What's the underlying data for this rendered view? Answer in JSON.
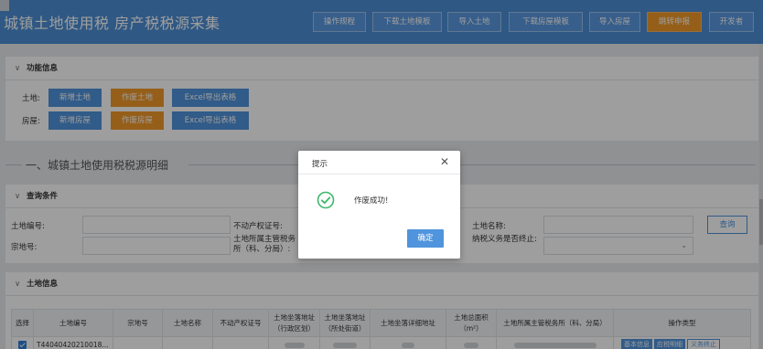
{
  "header": {
    "title": "城镇土地使用税 房产税税源采集",
    "buttons": [
      "操作规程",
      "下载土地模板",
      "导入土地",
      "下载房屋模板",
      "导入房屋",
      "跳转申报",
      "开发者"
    ]
  },
  "function_panel": {
    "title": "功能信息",
    "land_label": "土地:",
    "house_label": "房屋:",
    "land_buttons": [
      "新增土地",
      "作废土地",
      "Excel导出表格"
    ],
    "house_buttons": [
      "新增房屋",
      "作废房屋",
      "Excel导出表格"
    ]
  },
  "section_title": "一、城镇土地使用税税源明细",
  "query_panel": {
    "title": "查询条件",
    "fields": {
      "land_no": "土地编号:",
      "property_cert": "不动产权证号:",
      "land_name": "土地名称:",
      "parcel_no": "宗地号:",
      "tax_office": "土地所属主管税务所（科、分局）:",
      "obligation_end": "纳税义务是否终止:"
    },
    "query_button": "查询"
  },
  "land_panel": {
    "title": "土地信息",
    "columns": [
      "选择",
      "土地编号",
      "宗地号",
      "土地名称",
      "不动产权证号",
      "土地坐落地址（行政区划）",
      "土地坐落地址（所处街道）",
      "土地坐落详细地址",
      "土地总面积（m²）",
      "土地所属主管税务所（科、分局）",
      "操作类型"
    ],
    "rows": [
      {
        "checked": true,
        "land_no": "T44040420210018...",
        "actions": [
          "基本信息",
          "应税明细",
          "义务终止"
        ]
      }
    ]
  },
  "dialog": {
    "title": "提示",
    "message": "作废成功!",
    "ok_label": "确定",
    "icon": "check-circle-icon",
    "close_icon": "close-icon"
  },
  "colors": {
    "header_bg": "#4d8fd6",
    "primary": "#4f94dc",
    "orange": "#f19a2b",
    "success": "#3fb86b"
  }
}
